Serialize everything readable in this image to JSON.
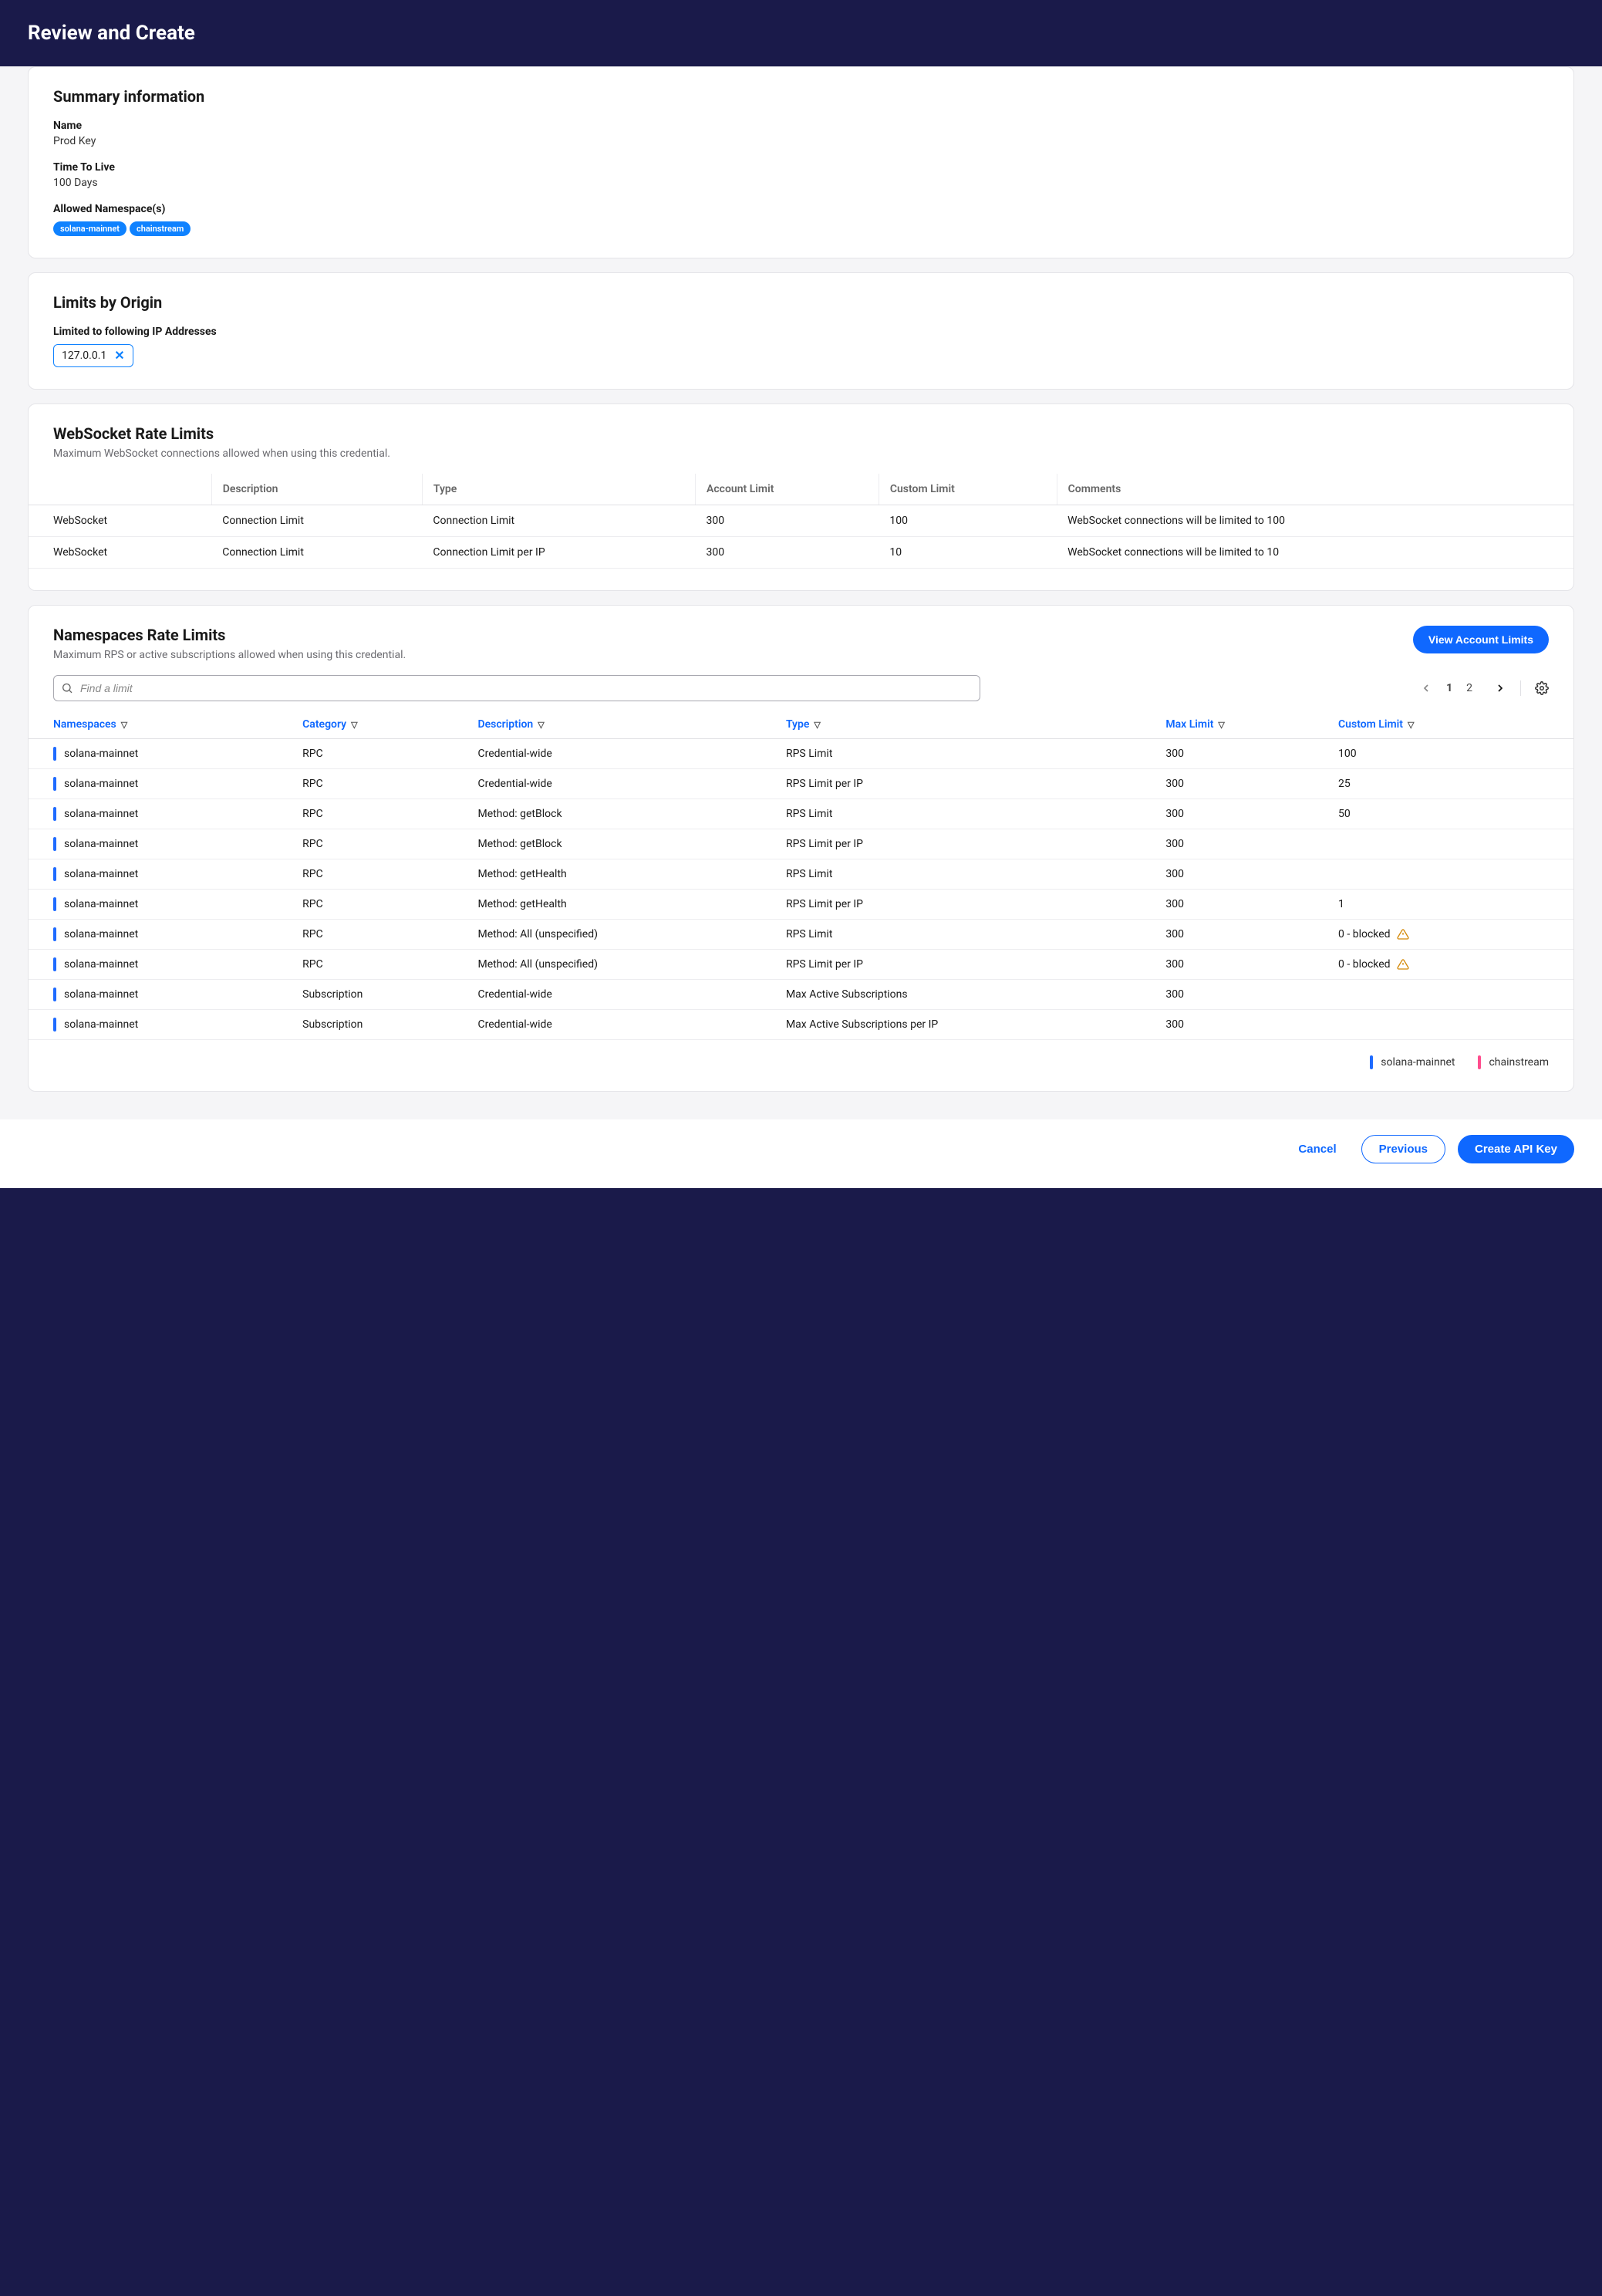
{
  "header": {
    "title": "Review and Create"
  },
  "summary": {
    "title": "Summary information",
    "name_label": "Name",
    "name_value": "Prod Key",
    "ttl_label": "Time To Live",
    "ttl_value": "100 Days",
    "ns_label": "Allowed Namespace(s)",
    "badges": [
      "solana-mainnet",
      "chainstream"
    ]
  },
  "origin": {
    "title": "Limits by Origin",
    "ip_label": "Limited to following IP Addresses",
    "chips": [
      "127.0.0.1"
    ]
  },
  "ws": {
    "title": "WebSocket Rate Limits",
    "subtitle": "Maximum WebSocket connections allowed when using this credential.",
    "cols": [
      "",
      "Description",
      "Type",
      "Account Limit",
      "Custom Limit",
      "Comments"
    ],
    "rows": [
      {
        "c0": "WebSocket",
        "c1": "Connection Limit",
        "c2": "Connection Limit",
        "c3": "300",
        "c4": "100",
        "c5": "WebSocket connections will be limited to 100"
      },
      {
        "c0": "WebSocket",
        "c1": "Connection Limit",
        "c2": "Connection Limit per IP",
        "c3": "300",
        "c4": "10",
        "c5": "WebSocket connections will be limited to 10"
      }
    ]
  },
  "ns": {
    "title": "Namespaces Rate Limits",
    "subtitle": "Maximum RPS or active subscriptions allowed when using this credential.",
    "view_btn": "View Account Limits",
    "search_placeholder": "Find a limit",
    "pages": [
      "1",
      "2"
    ],
    "current_page": "1",
    "cols": {
      "namespaces": "Namespaces",
      "category": "Category",
      "description": "Description",
      "type": "Type",
      "max": "Max Limit",
      "custom": "Custom Limit"
    },
    "rows": [
      {
        "ns": "solana-mainnet",
        "color": "blue",
        "cat": "RPC",
        "desc": "Credential-wide",
        "type": "RPS Limit",
        "max": "300",
        "custom": "100",
        "warn": false
      },
      {
        "ns": "solana-mainnet",
        "color": "blue",
        "cat": "RPC",
        "desc": "Credential-wide",
        "type": "RPS Limit per IP",
        "max": "300",
        "custom": "25",
        "warn": false
      },
      {
        "ns": "solana-mainnet",
        "color": "blue",
        "cat": "RPC",
        "desc": "Method: getBlock",
        "type": "RPS Limit",
        "max": "300",
        "custom": "50",
        "warn": false
      },
      {
        "ns": "solana-mainnet",
        "color": "blue",
        "cat": "RPC",
        "desc": "Method: getBlock",
        "type": "RPS Limit per IP",
        "max": "300",
        "custom": "",
        "warn": false
      },
      {
        "ns": "solana-mainnet",
        "color": "blue",
        "cat": "RPC",
        "desc": "Method: getHealth",
        "type": "RPS Limit",
        "max": "300",
        "custom": "",
        "warn": false
      },
      {
        "ns": "solana-mainnet",
        "color": "blue",
        "cat": "RPC",
        "desc": "Method: getHealth",
        "type": "RPS Limit per IP",
        "max": "300",
        "custom": "1",
        "warn": false
      },
      {
        "ns": "solana-mainnet",
        "color": "blue",
        "cat": "RPC",
        "desc": "Method: All (unspecified)",
        "type": "RPS Limit",
        "max": "300",
        "custom": "0 - blocked",
        "warn": true
      },
      {
        "ns": "solana-mainnet",
        "color": "blue",
        "cat": "RPC",
        "desc": "Method: All (unspecified)",
        "type": "RPS Limit per IP",
        "max": "300",
        "custom": "0 - blocked",
        "warn": true
      },
      {
        "ns": "solana-mainnet",
        "color": "blue",
        "cat": "Subscription",
        "desc": "Credential-wide",
        "type": "Max Active Subscriptions",
        "max": "300",
        "custom": "",
        "warn": false
      },
      {
        "ns": "solana-mainnet",
        "color": "blue",
        "cat": "Subscription",
        "desc": "Credential-wide",
        "type": "Max Active Subscriptions per IP",
        "max": "300",
        "custom": "",
        "warn": false
      }
    ],
    "legend": [
      {
        "color": "blue",
        "label": "solana-mainnet"
      },
      {
        "color": "pink",
        "label": "chainstream"
      }
    ]
  },
  "footer": {
    "cancel": "Cancel",
    "previous": "Previous",
    "create": "Create API Key"
  }
}
